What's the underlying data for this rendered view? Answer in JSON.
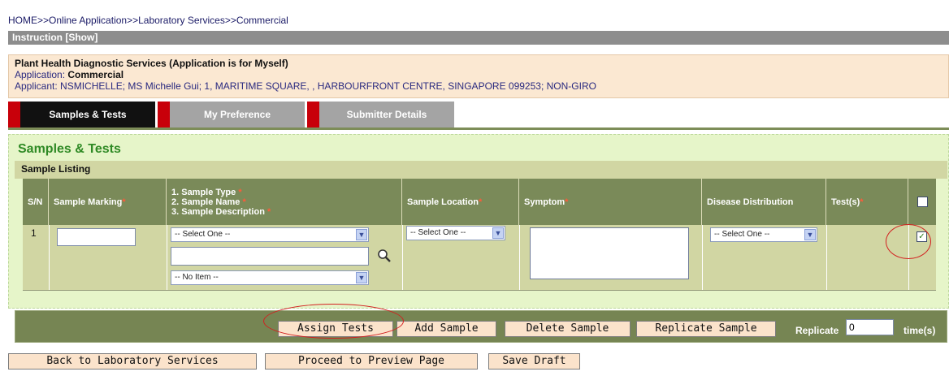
{
  "breadcrumb": {
    "home": "HOME",
    "sep": ">>",
    "online": "Online Application",
    "lab": "Laboratory Services",
    "commercial": "Commercial"
  },
  "instruction": {
    "label": "Instruction [Show]"
  },
  "application": {
    "title": "Plant Health Diagnostic Services (Application is for Myself)",
    "type_label": "Application:",
    "type_value": "Commercial",
    "applicant": "Applicant: NSMICHELLE; MS Michelle Gui; 1, MARITIME SQUARE, , HARBOURFRONT CENTRE, SINGAPORE 099253; NON-GIRO"
  },
  "tabs": [
    {
      "label": "Samples & Tests"
    },
    {
      "label": "My Preference"
    },
    {
      "label": "Submitter Details"
    }
  ],
  "section": {
    "title": "Samples & Tests",
    "listing": "Sample Listing"
  },
  "table": {
    "headers": {
      "sn": "S/N",
      "marking": "Sample Marking",
      "type1": "1. Sample Type",
      "type2": "2. Sample Name",
      "type3": "3. Sample Description",
      "location": "Sample Location",
      "symptom": "Symptom",
      "disease": "Disease Distribution",
      "tests": "Test(s)",
      "required": "*"
    },
    "rows": [
      {
        "sn": "1",
        "sample_type": "-- Select One --",
        "sample_item": "-- No Item --",
        "location": "-- Select One --",
        "disease": "-- Select One --",
        "checked_mark": "✓"
      }
    ]
  },
  "actions": {
    "assign": "Assign Tests",
    "add": "Add Sample",
    "delete": "Delete Sample",
    "replicate": "Replicate Sample",
    "replicate_label": "Replicate",
    "replicate_value": "0",
    "times": "time(s)"
  },
  "footer": {
    "back": "Back to Laboratory Services",
    "proceed": "Proceed to Preview Page",
    "save": "Save Draft"
  },
  "colors": {
    "accent_green": "#2f8a25",
    "header_olive": "#7a8a59",
    "tab_red": "#c8000a",
    "annotation_red": "#d21f1f"
  }
}
